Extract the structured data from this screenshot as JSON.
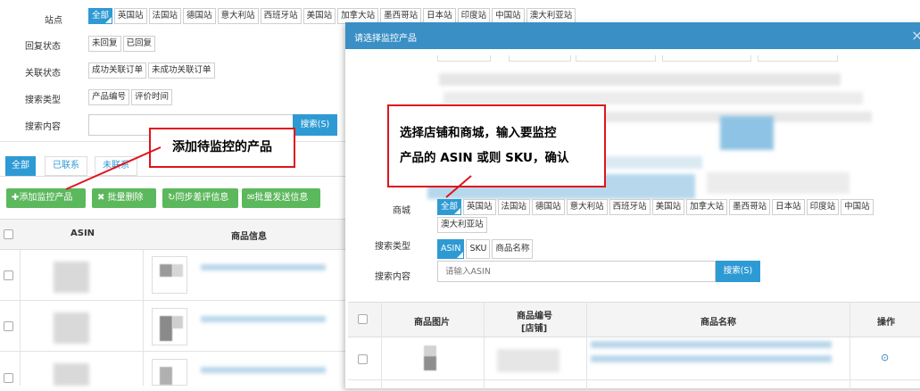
{
  "filters": {
    "site_label": "站点",
    "sites": [
      "全部",
      "英国站",
      "法国站",
      "德国站",
      "意大利站",
      "西班牙站",
      "美国站",
      "加拿大站",
      "墨西哥站",
      "日本站",
      "印度站",
      "中国站",
      "澳大利亚站"
    ],
    "reply_label": "回复状态",
    "reply_options": [
      "未回复",
      "已回复"
    ],
    "link_label": "关联状态",
    "link_options": [
      "成功关联订单",
      "未成功关联订单"
    ],
    "search_type_label": "搜索类型",
    "search_types": [
      "产品编号",
      "评价时间"
    ],
    "search_content_label": "搜索内容",
    "search_button": "搜索(S)"
  },
  "tabs": [
    "全部",
    "已联系",
    "未联系"
  ],
  "actions": {
    "add": "添加监控产品",
    "bulk_delete": "批量删除",
    "sync": "同步差评信息",
    "bulk_send": "批量发送信息"
  },
  "table": {
    "headers": [
      "ASIN",
      "商品信息"
    ]
  },
  "dialog": {
    "title": "请选择监控产品",
    "close": "×",
    "mall_label": "商城",
    "malls": [
      "全部",
      "英国站",
      "法国站",
      "德国站",
      "意大利站",
      "西班牙站",
      "美国站",
      "加拿大站",
      "墨西哥站",
      "日本站",
      "印度站",
      "中国站",
      "澳大利亚站"
    ],
    "search_type_label": "搜索类型",
    "search_types": [
      "ASIN",
      "SKU",
      "商品名称"
    ],
    "search_content_label": "搜索内容",
    "search_placeholder": "请输入ASIN",
    "search_button": "搜索(S)",
    "table_headers": {
      "image": "商品图片",
      "code_line1": "商品编号",
      "code_line2": "[店铺]",
      "name": "商品名称",
      "action": "操作"
    }
  },
  "annotations": {
    "left_callout": "添加待监控的产品",
    "right_callout_line1": "选择店铺和商城，输入要监控",
    "right_callout_line2": "产品的 ASIN 或则 SKU，确认"
  },
  "colors": {
    "primary_blue": "#2e9ad4",
    "dialog_header": "#3a8fc5",
    "action_green": "#5cb85c",
    "annotation_red": "#e0141b"
  }
}
